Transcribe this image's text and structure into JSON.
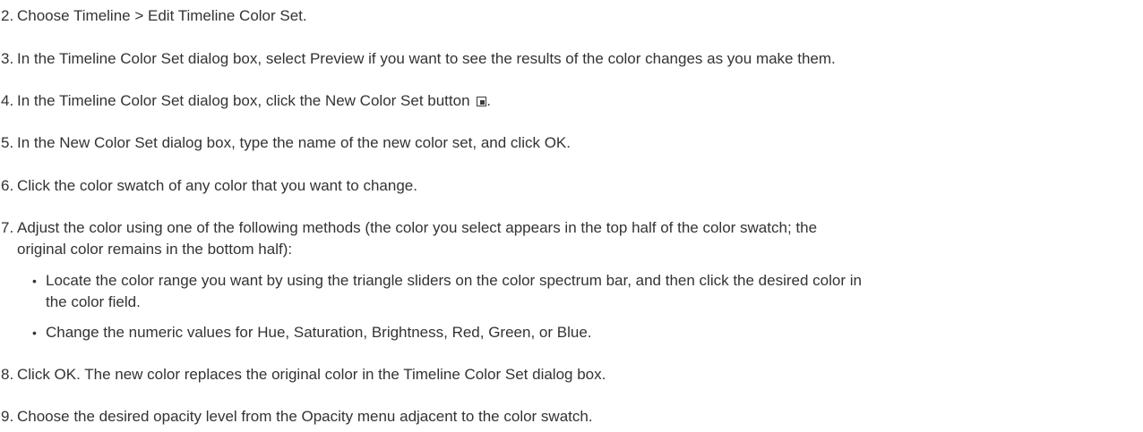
{
  "steps": [
    {
      "num": "2.",
      "text": "Choose Timeline > Edit Timeline Color Set."
    },
    {
      "num": "3.",
      "text": "In the Timeline Color Set dialog box, select Preview if you want to see the results of the color changes as you make them."
    },
    {
      "num": "4.",
      "text": "In the Timeline Color Set dialog box, click the New Color Set button",
      "after_icon": ".",
      "icon": "new-color-set-icon"
    },
    {
      "num": "5.",
      "text": "In the New Color Set dialog box, type the name of the new color set, and click OK."
    },
    {
      "num": "6.",
      "text": "Click the color swatch of any color that you want to change."
    },
    {
      "num": "7.",
      "line1": "Adjust the color using one of the following methods (the color you select appears in the top half of the color swatch; the",
      "line2": "original color remains in the bottom half):"
    },
    {
      "num": "8.",
      "text": "Click OK. The new color replaces the original color in the Timeline Color Set dialog box."
    },
    {
      "num": "9.",
      "text": "Choose the desired opacity level from the Opacity menu adjacent to the color swatch."
    }
  ],
  "substeps": [
    {
      "bullet": "•",
      "line1": "Locate the color range you want by using the triangle sliders on the color spectrum bar, and then click the desired color in",
      "line2": "the color field."
    },
    {
      "bullet": "•",
      "text": "Change the numeric values for Hue, Saturation, Brightness, Red, Green, or Blue."
    }
  ]
}
